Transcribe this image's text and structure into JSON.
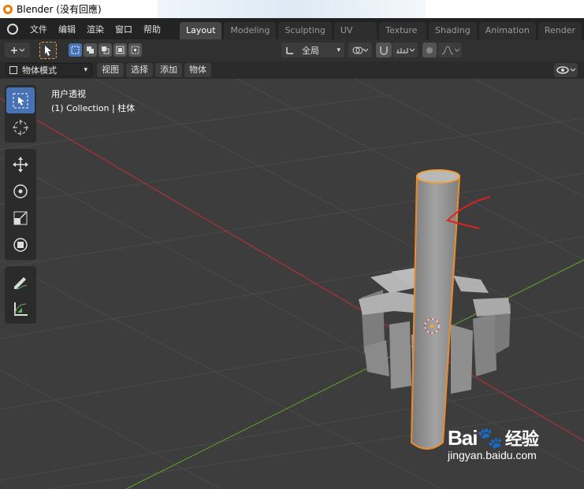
{
  "window": {
    "title": "Blender (没有回應)"
  },
  "menu": [
    "文件",
    "编辑",
    "渲染",
    "窗口",
    "帮助"
  ],
  "workspace_tabs": [
    "Layout",
    "Modeling",
    "Sculpting",
    "UV Editing",
    "Texture Paint",
    "Shading",
    "Animation",
    "Render"
  ],
  "active_tab": "Layout",
  "header": {
    "orientation": "全局"
  },
  "header2": {
    "mode": "物体模式",
    "view": "视图",
    "select": "选择",
    "add": "添加",
    "object": "物体"
  },
  "viewport": {
    "perspective": "用户透视",
    "collection": "(1) Collection | 柱体"
  },
  "watermark": {
    "brand": "Bai",
    "brand2": "经验",
    "url": "jingyan.baidu.com"
  },
  "colors": {
    "accent": "#4772b3",
    "selection": "#f2a03c",
    "x_axis": "#a8323a",
    "y_axis": "#5c8f28"
  }
}
